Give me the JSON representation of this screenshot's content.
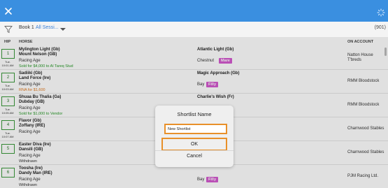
{
  "header": {
    "close_icon": "close-icon",
    "gear_icon": "spinner-icon"
  },
  "filterbar": {
    "book": "Book 1",
    "session": "All Sessi...",
    "count": "(901)"
  },
  "columns": {
    "hip": "HIP",
    "horse": "HORSE",
    "account": "ON ACCOUNT"
  },
  "rows": [
    {
      "hip": "1",
      "day": "Tue.",
      "time": "10:01 AM",
      "sire": "Mylington Light (Gb)",
      "horse": "Mount Nelson (GB)",
      "type": "Racing Age",
      "note": "Sold for $4,000 to Al Tareq Stud",
      "note_color": "#2a9a2a",
      "dam": "Atlantic Light (Gb)",
      "color": "Chestnut",
      "sex": "Mare",
      "sex_color": "#d45bd0",
      "account": "Natton House T'breds"
    },
    {
      "hip": "2",
      "day": "Tue.",
      "time": "10:03 AM",
      "sire": "Sadiiki (Gb)",
      "horse": "Land Force (Ire)",
      "type": "Racing Age",
      "note": "RNA for $1,600",
      "note_color": "#e07a1f",
      "dam": "Magic Approach (Gb)",
      "color": "Bay",
      "sex": "Filly",
      "sex_color": "#d45bd0",
      "account": "RMM Bloodstock"
    },
    {
      "hip": "3",
      "day": "Tue.",
      "time": "10:05 AM",
      "sire": "Shuaa Bu Thalia (Ga)",
      "horse": "Dubday (GB)",
      "type": "Racing Age",
      "note": "Sold for $1,000 to Vendor",
      "note_color": "#2a9a2a",
      "dam": "Charlie's Wish (Fr)",
      "color": "",
      "sex": "",
      "sex_color": "#d45bd0",
      "account": "RMM Bloodstock"
    },
    {
      "hip": "4",
      "day": "Tue.",
      "time": "10:07 AM",
      "sire": "Flavor (Gb)",
      "horse": "Zoffany (IRE)",
      "type": "Racing Age",
      "note": "",
      "note_color": "#2a9a2a",
      "dam": "",
      "color": "",
      "sex": "",
      "sex_color": "#d45bd0",
      "account": "Charnwood Stables"
    },
    {
      "hip": "5",
      "day": "",
      "time": "",
      "sire": "Easter Diva (Ire)",
      "horse": "Dansili (GB)",
      "type": "Racing Age",
      "note": "Withdrawn",
      "note_color": "#333333",
      "dam": "",
      "color": "",
      "sex": "",
      "sex_color": "#d45bd0",
      "account": "Charnwood Stables"
    },
    {
      "hip": "6",
      "day": "",
      "time": "",
      "sire": "Toosha (Ire)",
      "horse": "Dandy Man (IRE)",
      "type": "Racing Age",
      "note": "Withdrawn",
      "note_color": "#333333",
      "dam": "",
      "color": "Bay",
      "sex": "Filly",
      "sex_color": "#d45bd0",
      "account": "PJM Racing Ltd."
    }
  ],
  "dialog": {
    "title": "Shortlist Name",
    "input_value": "New Shortlist",
    "ok_label": "OK",
    "cancel_label": "Cancel"
  },
  "colors": {
    "topbar": "#3a8fe0",
    "accent_orange": "#e8902a",
    "hip_green": "#3b9a3b",
    "link_blue": "#3a7fd6"
  }
}
